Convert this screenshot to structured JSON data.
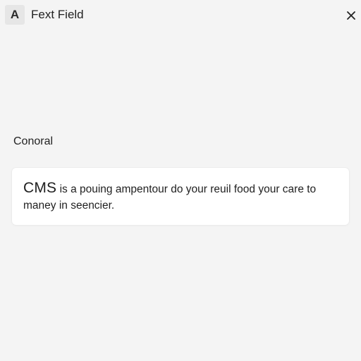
{
  "header": {
    "field_type_icon_text": "A",
    "title": "Fext Field",
    "close_icon": "close-icon"
  },
  "section": {
    "label": "Conoral"
  },
  "field": {
    "lead": "CMS",
    "value": " is a pouing ampentour do your reuil food your care to maney in seencier."
  }
}
